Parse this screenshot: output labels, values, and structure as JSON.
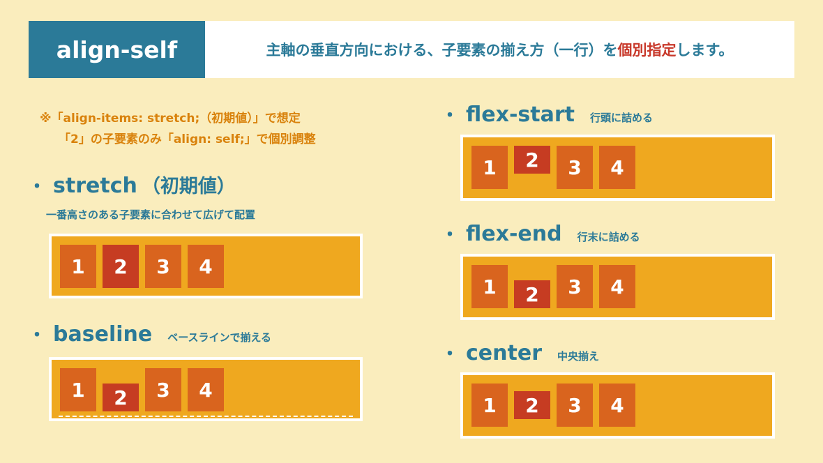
{
  "header": {
    "property": "align-self",
    "description_part1": "主軸の垂直方向における、子要素の揃え方（一行）を",
    "description_emphasis": "個別指定",
    "description_part2": "します。"
  },
  "note": {
    "line1": "※「align-items: stretch;（初期値）」で想定",
    "line2": "「2」の子要素のみ「align: self;」で個別調整"
  },
  "bullet": "・",
  "sections": {
    "stretch": {
      "name": "stretch",
      "suffix": "（初期値）",
      "caption": "一番高さのある子要素に合わせて広げて配置",
      "items": [
        "1",
        "2",
        "3",
        "4"
      ]
    },
    "baseline": {
      "name": "baseline",
      "sub": "ベースラインで揃える",
      "items": [
        "1",
        "2",
        "3",
        "4"
      ]
    },
    "flex_start": {
      "name": "flex-start",
      "sub": "行頭に詰める",
      "items": [
        "1",
        "2",
        "3",
        "4"
      ]
    },
    "flex_end": {
      "name": "flex-end",
      "sub": "行末に詰める",
      "items": [
        "1",
        "2",
        "3",
        "4"
      ]
    },
    "center": {
      "name": "center",
      "sub": "中央揃え",
      "items": [
        "1",
        "2",
        "3",
        "4"
      ]
    }
  },
  "colors": {
    "accent_blue": "#2b7a98",
    "accent_red": "#c8392b",
    "note_orange": "#d9820c",
    "container": "#efa81f",
    "item": "#d9641e",
    "item_highlight": "#c63c22",
    "background": "#faedbd"
  }
}
